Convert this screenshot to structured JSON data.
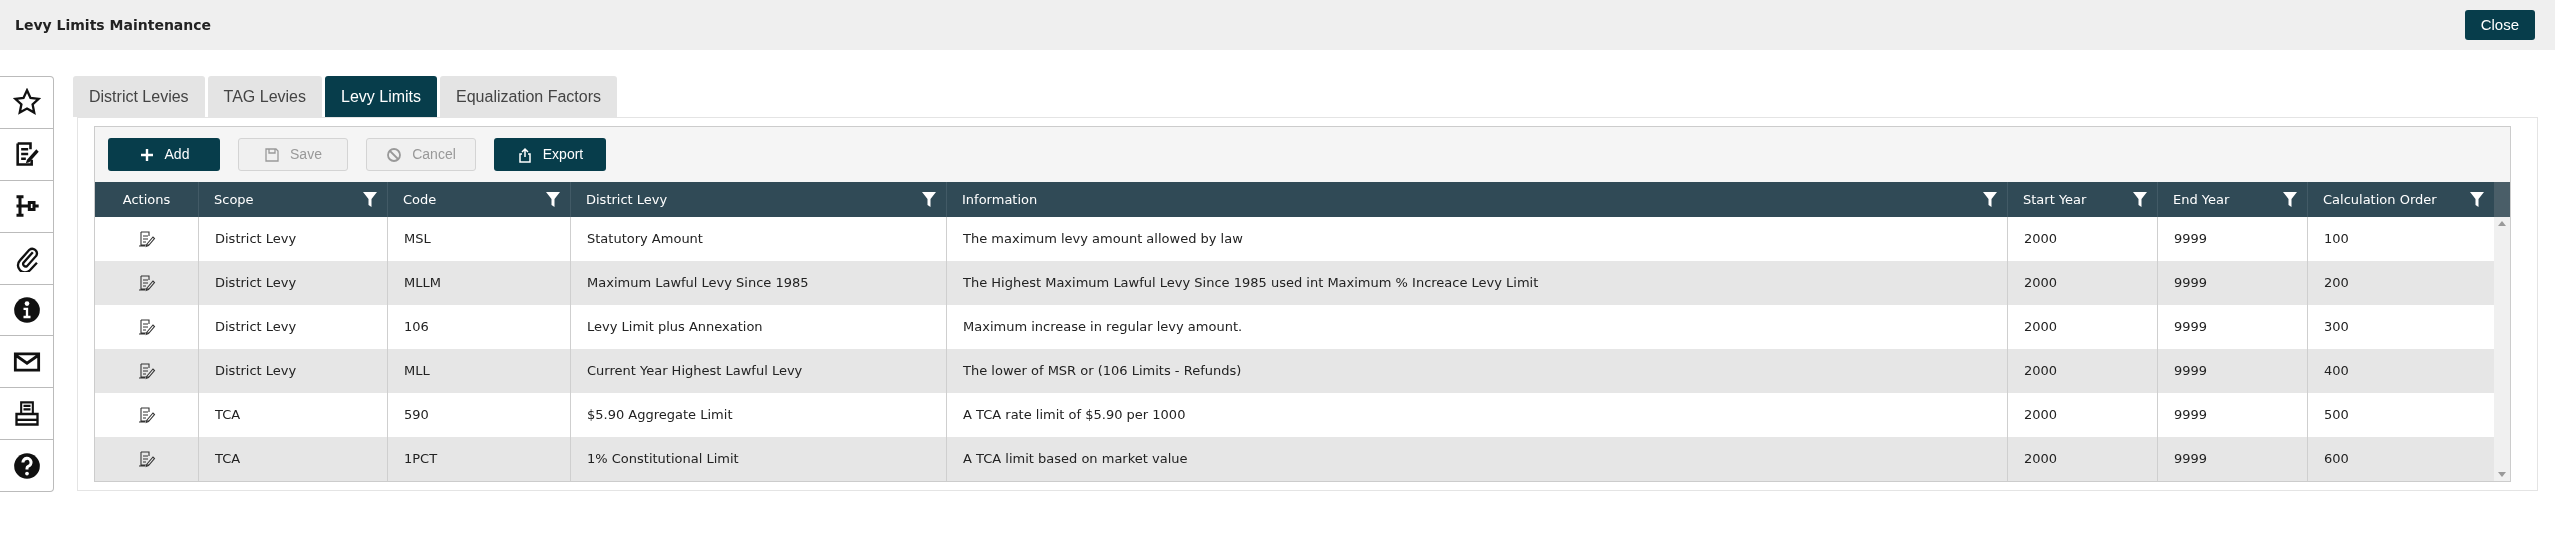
{
  "window": {
    "title": "Levy Limits Maintenance",
    "close_button": "Close"
  },
  "tabs": [
    {
      "label": "District Levies",
      "selected": false
    },
    {
      "label": "TAG Levies",
      "selected": false
    },
    {
      "label": "Levy Limits",
      "selected": true
    },
    {
      "label": "Equalization Factors",
      "selected": false
    }
  ],
  "toolbar": [
    {
      "label": "Add",
      "disabled": false
    },
    {
      "label": "Save",
      "disabled": true
    },
    {
      "label": "Cancel",
      "disabled": true
    },
    {
      "label": "Export",
      "disabled": false
    }
  ],
  "table": {
    "columns": [
      {
        "label": "Actions",
        "filter": false
      },
      {
        "label": "Scope",
        "filter": true
      },
      {
        "label": "Code",
        "filter": true
      },
      {
        "label": "District Levy",
        "filter": true
      },
      {
        "label": "Information",
        "filter": true
      },
      {
        "label": "Start Year",
        "filter": true
      },
      {
        "label": "End Year",
        "filter": true
      },
      {
        "label": "Calculation Order",
        "filter": true
      }
    ],
    "rows": [
      [
        "",
        "District Levy",
        "MSL",
        "Statutory Amount",
        "The maximum levy amount allowed by law",
        "2000",
        "9999",
        "100"
      ],
      [
        "",
        "District Levy",
        "MLLM",
        "Maximum Lawful Levy Since 1985",
        "The Highest Maximum Lawful Levy Since 1985 used int Maximum % Increace Levy Limit",
        "2000",
        "9999",
        "200"
      ],
      [
        "",
        "District Levy",
        "106",
        "Levy Limit plus Annexation",
        "Maximum increase in regular levy amount.",
        "2000",
        "9999",
        "300"
      ],
      [
        "",
        "District Levy",
        "MLL",
        "Current Year Highest Lawful Levy",
        "The lower of MSR or (106 Limits - Refunds)",
        "2000",
        "9999",
        "400"
      ],
      [
        "",
        "TCA",
        "590",
        "$5.90 Aggregate Limit",
        "A TCA rate limit of $5.90 per 1000",
        "2000",
        "9999",
        "500"
      ],
      [
        "",
        "TCA",
        "1PCT",
        "1% Constitutional Limit",
        "A TCA limit based on market value",
        "2000",
        "9999",
        "600"
      ]
    ]
  }
}
